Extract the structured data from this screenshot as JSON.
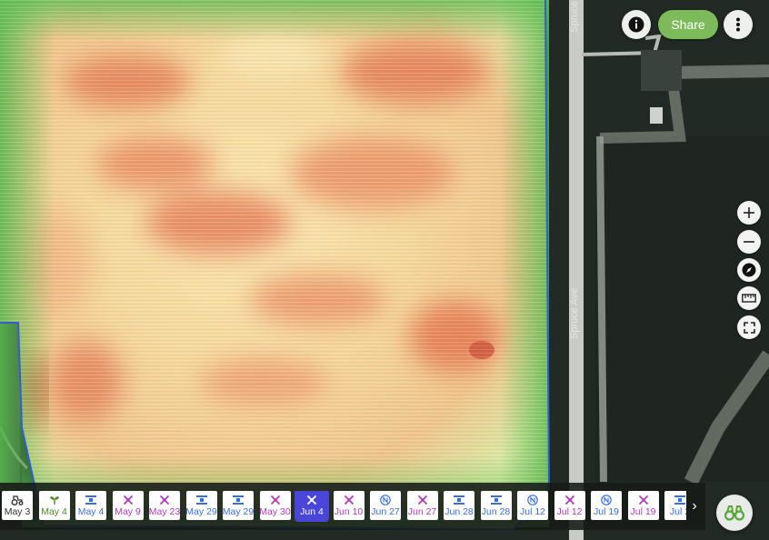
{
  "map": {
    "road_label_main": "Spruce Ave",
    "road_label_top": "Spruce"
  },
  "header": {
    "share_label": "Share",
    "info_icon": "info-icon",
    "more_icon": "more-vertical-icon"
  },
  "tools": [
    {
      "name": "zoom-in-button",
      "icon": "plus-icon"
    },
    {
      "name": "zoom-out-button",
      "icon": "minus-icon"
    },
    {
      "name": "compass-button",
      "icon": "compass-icon"
    },
    {
      "name": "measure-button",
      "icon": "ruler-icon"
    },
    {
      "name": "fullscreen-button",
      "icon": "fullscreen-icon"
    }
  ],
  "timeline": {
    "selected": "Jun 4",
    "next_icon": "chevron-right-icon",
    "items": [
      {
        "label": "May 3",
        "icon": "tractor-icon",
        "color": "#333333"
      },
      {
        "label": "May 4",
        "icon": "sprout-icon",
        "color": "#4f8a2e"
      },
      {
        "label": "May 4",
        "icon": "satellite-icon",
        "color": "#3b6fd8"
      },
      {
        "label": "May 9",
        "icon": "drone-icon",
        "color": "#b03ab8"
      },
      {
        "label": "May 23",
        "icon": "drone-icon",
        "color": "#b03ab8"
      },
      {
        "label": "May 29",
        "icon": "satellite-icon",
        "color": "#3b6fd8"
      },
      {
        "label": "May 29",
        "icon": "satellite-icon",
        "color": "#3b6fd8"
      },
      {
        "label": "May 30",
        "icon": "drone-icon",
        "color": "#b03ab8"
      },
      {
        "label": "Jun 4",
        "icon": "drone-icon",
        "color": "#ffffff",
        "active": true
      },
      {
        "label": "Jun 10",
        "icon": "drone-icon",
        "color": "#b03ab8"
      },
      {
        "label": "Jun 27",
        "icon": "naip-icon",
        "color": "#3b6fd8"
      },
      {
        "label": "Jun 27",
        "icon": "drone-icon",
        "color": "#b03ab8"
      },
      {
        "label": "Jun 28",
        "icon": "satellite-icon",
        "color": "#3b6fd8"
      },
      {
        "label": "Jun 28",
        "icon": "satellite-icon",
        "color": "#3b6fd8"
      },
      {
        "label": "Jul 12",
        "icon": "naip-icon",
        "color": "#3b6fd8"
      },
      {
        "label": "Jul 12",
        "icon": "drone-icon",
        "color": "#b03ab8"
      },
      {
        "label": "Jul 19",
        "icon": "naip-icon",
        "color": "#3b6fd8"
      },
      {
        "label": "Jul 19",
        "icon": "drone-icon",
        "color": "#b03ab8"
      },
      {
        "label": "Jul 2",
        "icon": "satellite-icon",
        "color": "#3b6fd8"
      }
    ]
  },
  "compare_icon": "binoculars-icon",
  "colors": {
    "share": "#7dbb5a",
    "active_chip": "#4a46d8",
    "field_outline": "#2f5fd0",
    "ndvi_low": "#d8452f",
    "ndvi_mid": "#f7e3a8",
    "ndvi_high": "#4fb34a"
  }
}
